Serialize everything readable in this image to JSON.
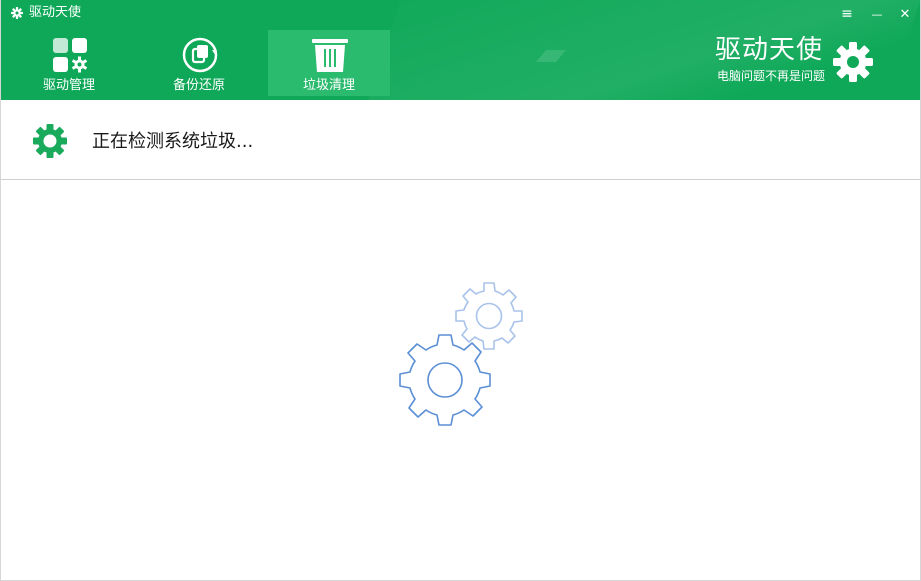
{
  "window": {
    "title": "驱动天使"
  },
  "titlebar": {
    "menu_glyph": "≡",
    "minimize_glyph": "—",
    "close_glyph": "✕"
  },
  "nav": {
    "items": [
      {
        "label": "驱动管理",
        "icon": "driver-management-icon"
      },
      {
        "label": "备份还原",
        "icon": "backup-restore-icon"
      },
      {
        "label": "垃圾清理",
        "icon": "trash-icon",
        "active": true
      }
    ]
  },
  "brand": {
    "title": "驱动天使",
    "subtitle": "电脑问题不再是问题",
    "icon": "gear-icon"
  },
  "status": {
    "text": "正在检测系统垃圾...",
    "icon": "gear-icon"
  },
  "loading": {
    "icon": "gears-loading-icon"
  },
  "colors": {
    "header_green": "#0ea858",
    "active_tab": "#2bbb6e",
    "status_gear": "#1aaa5c",
    "loading_gear_stroke": "#5b8fd6"
  }
}
